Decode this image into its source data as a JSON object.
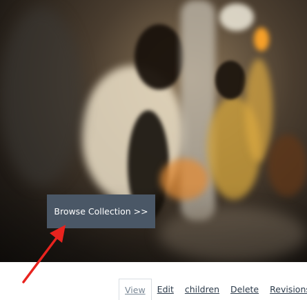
{
  "hero": {
    "image_description": "photo-crowd-scene"
  },
  "browse_button": {
    "label": "Browse Collection >>"
  },
  "annotation": {
    "arrow_color": "#e8231e"
  },
  "tabs": [
    {
      "label": "View",
      "active": true
    },
    {
      "label": "Edit",
      "active": false
    },
    {
      "label": "children",
      "active": false
    },
    {
      "label": "Delete",
      "active": false
    },
    {
      "label": "Revisions",
      "active": false
    }
  ]
}
